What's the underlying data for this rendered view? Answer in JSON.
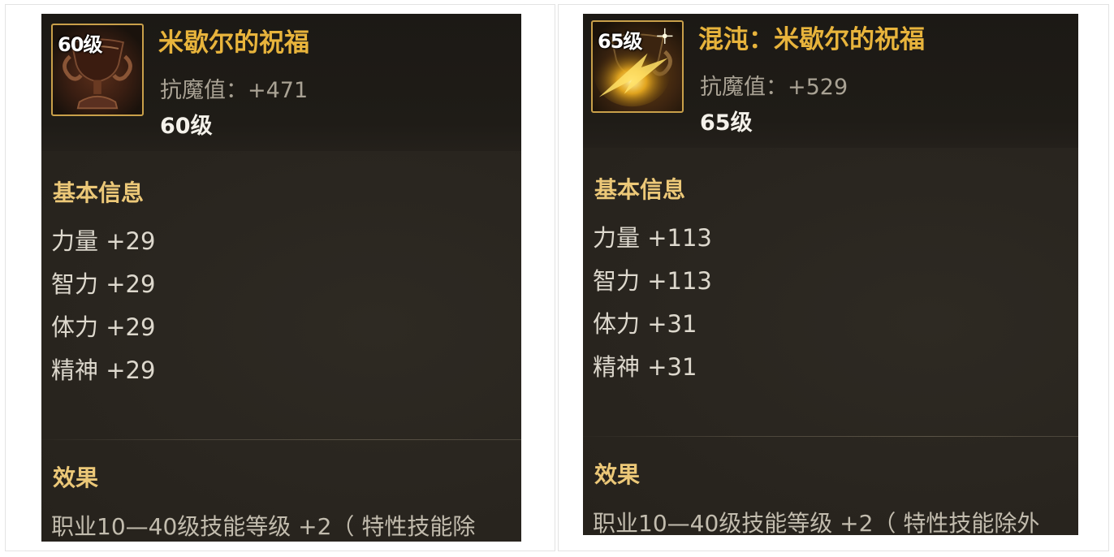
{
  "cards": [
    {
      "icon_name": "goblet-icon",
      "icon_level": "60级",
      "name": "米歇尔的祝福",
      "stat": "抗魔值：+471",
      "level": "60级",
      "basic_title": "基本信息",
      "attributes": [
        "力量 +29",
        "智力 +29",
        "体力 +29",
        "精神 +29"
      ],
      "effect_title": "效果",
      "effect_text": "职业10—40级技能等级 +2（ 特性技能除"
    },
    {
      "icon_name": "glowing-goblet-icon",
      "icon_level": "65级",
      "name": "混沌：米歇尔的祝福",
      "stat": "抗魔值：+529",
      "level": "65级",
      "basic_title": "基本信息",
      "attributes": [
        "力量 +113",
        "智力 +113",
        "体力 +31",
        "精神 +31"
      ],
      "effect_title": "效果",
      "effect_text": "职业10—40级技能等级 +2（ 特性技能除外"
    }
  ],
  "colors": {
    "name": "#e8b43c",
    "section_title": "#ecc878",
    "icon_border": "#c9a04a",
    "card_bg": "#2a2620"
  }
}
